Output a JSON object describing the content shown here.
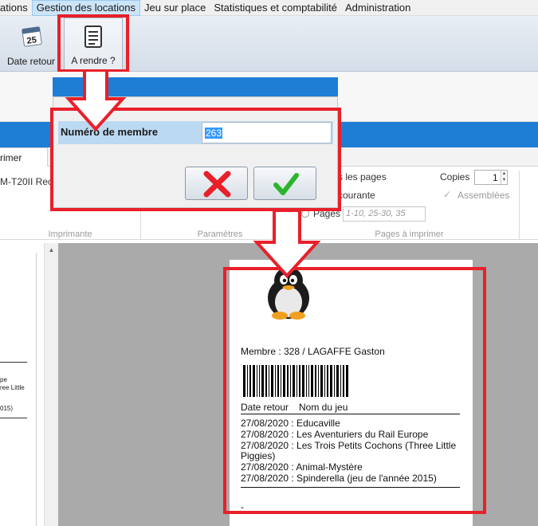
{
  "menu": {
    "items": [
      {
        "label": "ations",
        "active": false
      },
      {
        "label": "Gestion des locations",
        "active": true
      },
      {
        "label": "Jeu sur place",
        "active": false
      },
      {
        "label": "Statistiques et comptabilité",
        "active": false
      },
      {
        "label": "Administration",
        "active": false
      }
    ]
  },
  "ribbon": {
    "date_retour_label": "Date retour",
    "date_icon_day": "25",
    "a_rendre_label": "A rendre ?"
  },
  "print_panel": {
    "tab_label": "rimer",
    "printer_name": "M-T20II Rec",
    "all_pages_label": "s les pages",
    "current_page_label": "courante",
    "pages_label": "Pages",
    "pages_placeholder": "1-10, 25-30, 35",
    "copies_label": "Copies",
    "copies_value": "1",
    "collated_label": "Assemblées",
    "group_printer": "Imprimante",
    "group_params": "Paramètres",
    "group_pages": "Pages à imprimer"
  },
  "dialog": {
    "member_label": "Numéro de membre",
    "member_value": "263",
    "cancel_icon": "red-x-icon",
    "ok_icon": "green-check-icon"
  },
  "left_preview": {
    "line1": "pe",
    "line2": "ree Little",
    "line3": "015)"
  },
  "ticket": {
    "member_line": "Membre : 328 / LAGAFFE Gaston",
    "col_date": "Date retour",
    "col_game": "Nom du jeu",
    "rows": [
      "27/08/2020 : Educaville",
      "27/08/2020 : Les Aventuriers du Rail Europe",
      "27/08/2020 : Les Trois Petits Cochons (Three Little",
      "Piggies)",
      "27/08/2020 : Animal-Mystère",
      "27/08/2020 : Spinderella (jeu de l'année 2015)"
    ],
    "footer": "-"
  },
  "colors": {
    "highlight_red": "#e8202a",
    "title_blue": "#1e7ed6",
    "selection_blue": "#3399ff",
    "ok_green": "#2bb52b"
  }
}
